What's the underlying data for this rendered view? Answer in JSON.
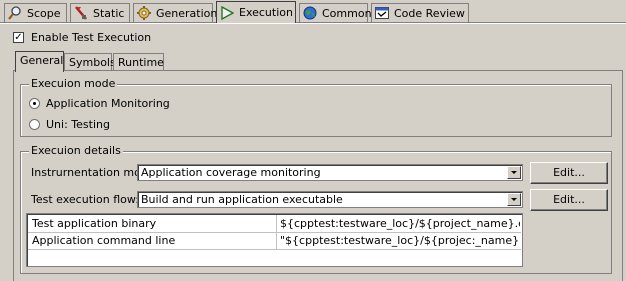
{
  "top_tabs": [
    {
      "label": "Scope",
      "icon": "magnifier-icon",
      "active": false
    },
    {
      "label": "Static",
      "icon": "wand-icon",
      "active": false
    },
    {
      "label": "Generation",
      "icon": "gear-icon",
      "active": false
    },
    {
      "label": "Execution",
      "icon": "play-icon",
      "active": true
    },
    {
      "label": "Common",
      "icon": "globe-icon",
      "active": false
    },
    {
      "label": "Code Review",
      "icon": "code-review-icon",
      "active": false
    }
  ],
  "enable_test_execution": {
    "label": "Enable Test Execution",
    "checked": true
  },
  "sub_tabs": [
    {
      "label": "General",
      "active": true
    },
    {
      "label": "Symbols",
      "active": false
    },
    {
      "label": "Runtime",
      "active": false
    }
  ],
  "execution_mode": {
    "title": "Execuion mode",
    "options": [
      {
        "label": "Application Monitoring",
        "selected": true
      },
      {
        "label": "Uni: Testing",
        "selected": false
      }
    ]
  },
  "execution_details": {
    "title": "Execuion details",
    "instrumentation_mode": {
      "label": "Instrurnentation mode:",
      "value": "Application coverage monitoring",
      "button": "Edit..."
    },
    "test_execution_flow": {
      "label": "Test execution flow:",
      "value": "Build and run application executable",
      "button": "Edit..."
    },
    "table": [
      {
        "name": "Test application binary",
        "value": "${cpptest:testware_loc}/${project_name}.exe"
      },
      {
        "name": "Application command line",
        "value": "\"${cpptest:testware_loc}/${projec:_name}.exe\""
      }
    ]
  }
}
